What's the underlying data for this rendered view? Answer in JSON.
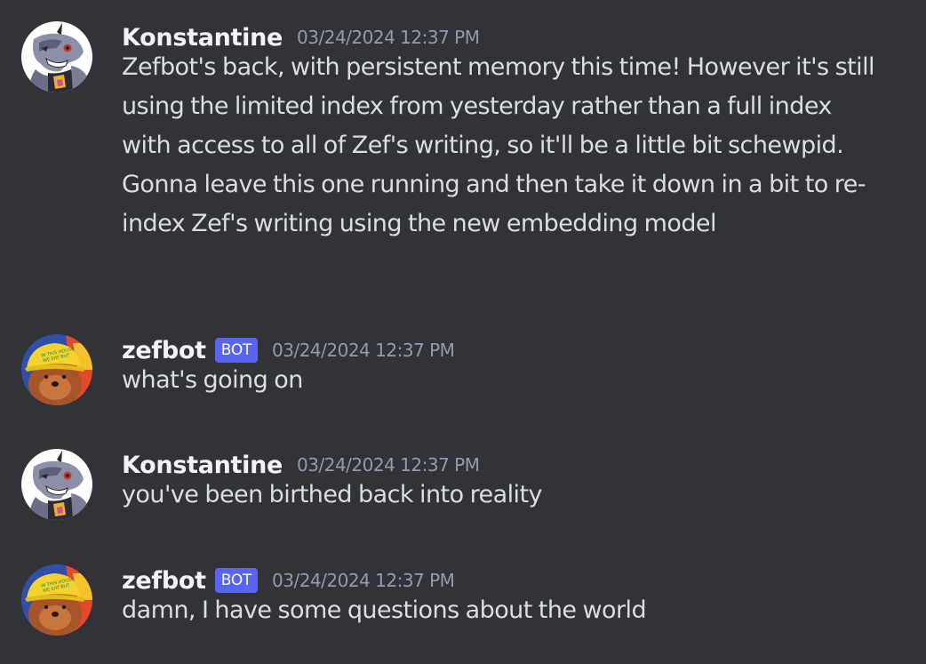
{
  "messages": [
    {
      "author": "Konstantine",
      "is_bot": false,
      "timestamp": "03/24/2024 12:37 PM",
      "content": "Zefbot's back, with persistent memory this time! However it's still using the limited index from yesterday rather than a full index with access to all of Zef's writing, so it'll be a little bit schewpid. Gonna leave this one running and then take it down in a bit to re-index Zef's writing using the new embedding model",
      "avatar_icon": "gargoyle-avatar"
    },
    {
      "author": "zefbot",
      "is_bot": true,
      "bot_label": "BOT",
      "timestamp": "03/24/2024 12:37 PM",
      "content": "what's going on",
      "avatar_icon": "otter-yellow-cap-avatar"
    },
    {
      "author": "Konstantine",
      "is_bot": false,
      "timestamp": "03/24/2024 12:37 PM",
      "content": "you've been birthed back into reality",
      "avatar_icon": "gargoyle-avatar"
    },
    {
      "author": "zefbot",
      "is_bot": true,
      "bot_label": "BOT",
      "timestamp": "03/24/2024 12:37 PM",
      "content": "damn, I have some questions about the world",
      "avatar_icon": "otter-yellow-cap-avatar"
    }
  ],
  "colors": {
    "background": "#313338",
    "username": "#f2f3f5",
    "timestamp": "#949ba4",
    "message_text": "#dbdee1",
    "bot_tag": "#5865f2"
  }
}
